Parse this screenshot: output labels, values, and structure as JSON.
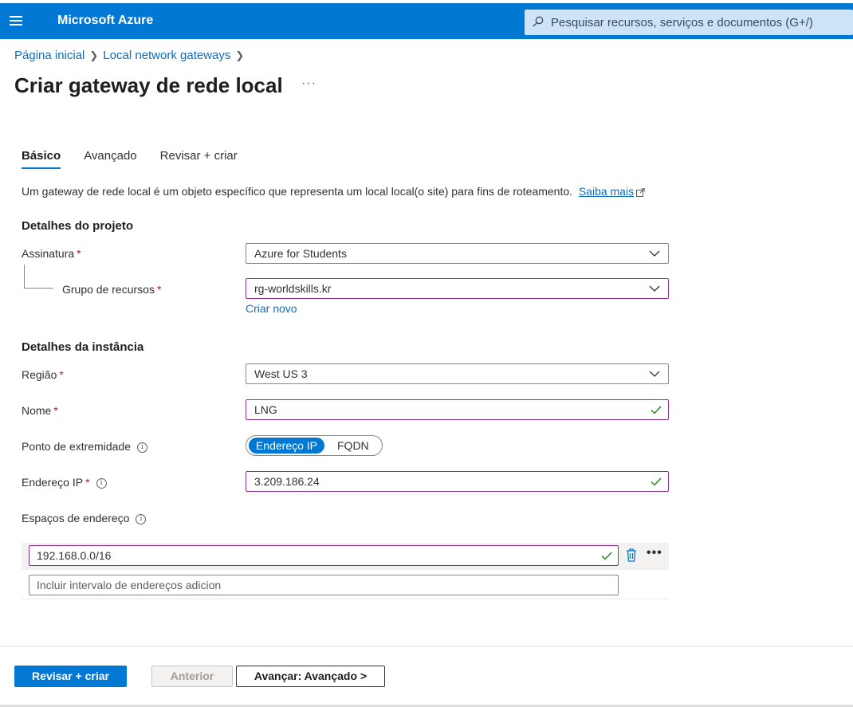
{
  "header": {
    "brand": "Microsoft Azure",
    "search_placeholder": "Pesquisar recursos, serviços e documentos (G+/)"
  },
  "breadcrumb": {
    "items": [
      "Página inicial",
      "Local network gateways"
    ]
  },
  "page": {
    "title": "Criar gateway de rede local",
    "more": "···"
  },
  "tabs": [
    {
      "label": "Básico",
      "active": true
    },
    {
      "label": "Avançado",
      "active": false
    },
    {
      "label": "Revisar + criar",
      "active": false
    }
  ],
  "description": {
    "text": "Um gateway de rede local é um objeto específico que representa um local local(o site) para fins de roteamento.",
    "link": "Saiba mais"
  },
  "project": {
    "title": "Detalhes do projeto",
    "subscription_label": "Assinatura",
    "subscription_value": "Azure for Students",
    "resource_group_label": "Grupo de recursos",
    "resource_group_value": "rg-worldskills.kr",
    "create_new": "Criar novo"
  },
  "instance": {
    "title": "Detalhes da instância",
    "region_label": "Região",
    "region_value": "West US 3",
    "name_label": "Nome",
    "name_value": "LNG",
    "endpoint_label": "Ponto de extremidade",
    "endpoint_options": [
      "Endereço IP",
      "FQDN"
    ],
    "ip_label": "Endereço IP",
    "ip_value": "3.209.186.24",
    "address_spaces_label": "Espaços de endereço",
    "address_spaces": [
      "192.168.0.0/16"
    ],
    "address_placeholder": "Incluir intervalo de endereços adicion"
  },
  "footer": {
    "review_create": "Revisar + criar",
    "previous": "Anterior",
    "next": "Avançar: Avançado >"
  },
  "required_mark": "*",
  "colors": {
    "accent": "#0078d4",
    "link": "#0f6cbd",
    "required": "#a4262c",
    "focus_border": "#8f2d8f",
    "valid_check": "#107c10"
  }
}
